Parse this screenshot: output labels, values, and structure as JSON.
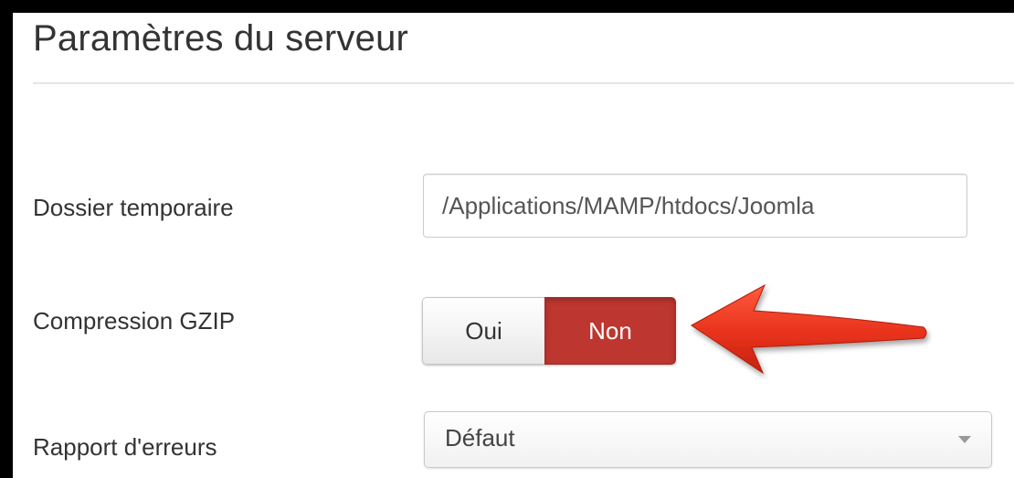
{
  "page": {
    "title": "Paramètres du serveur"
  },
  "fields": {
    "temp_folder": {
      "label": "Dossier temporaire",
      "value": "/Applications/MAMP/htdocs/Joomla"
    },
    "gzip": {
      "label": "Compression GZIP",
      "options": [
        "Oui",
        "Non"
      ],
      "selected": "Non"
    },
    "error_reporting": {
      "label": "Rapport d'erreurs",
      "selected": "Défaut"
    }
  },
  "annotation": {
    "icon": "red-arrow-pointer",
    "color": "#e8321c"
  },
  "colors": {
    "active_toggle": "#bd362f",
    "divider": "#e6e6e6",
    "background_frame": "#000000"
  }
}
